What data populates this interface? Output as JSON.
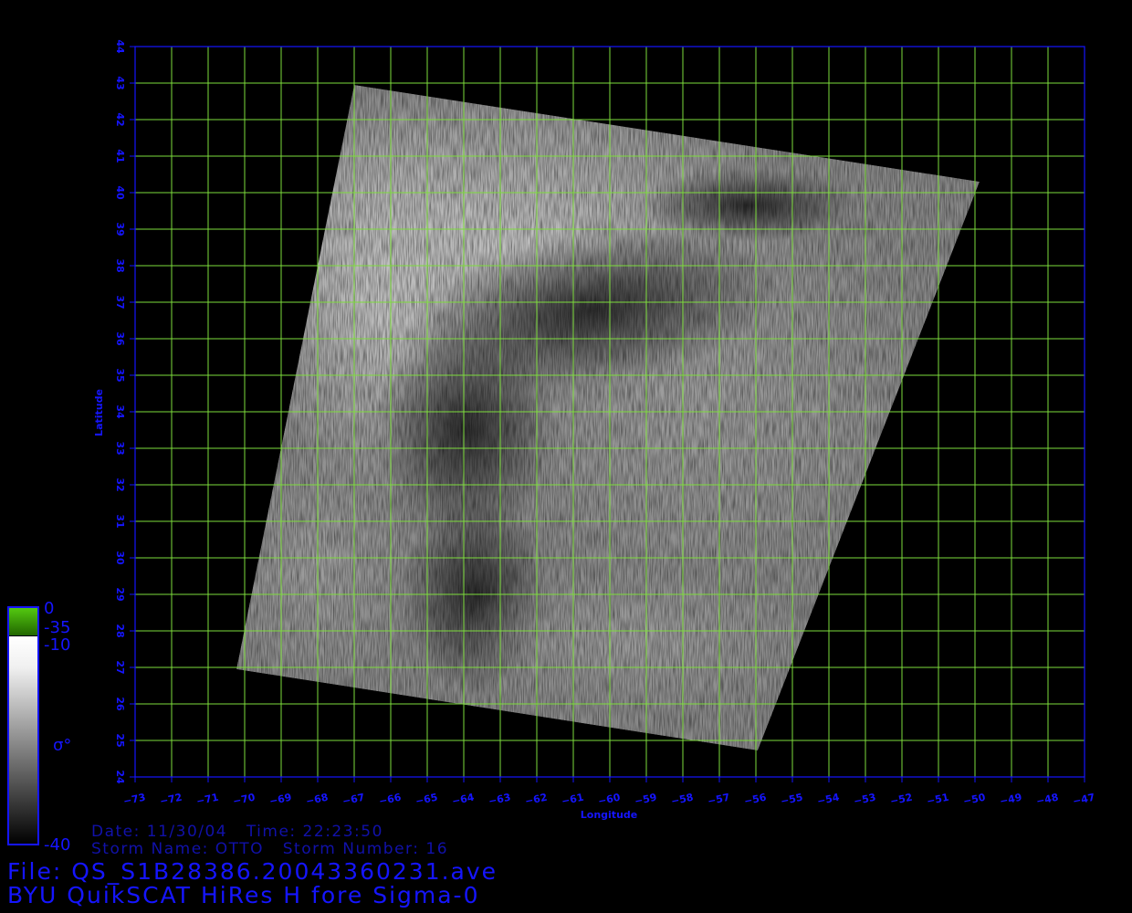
{
  "map": {
    "x_axis_label": "Longitude",
    "y_axis_label": "Latitude",
    "lon_range": [
      -73,
      -47
    ],
    "lat_range": [
      24,
      44
    ],
    "lon_ticks": [
      -73,
      -72,
      -71,
      -70,
      -69,
      -68,
      -67,
      -66,
      -65,
      -64,
      -63,
      -62,
      -61,
      -60,
      -59,
      -58,
      -57,
      -56,
      -55,
      -54,
      -53,
      -52,
      -51,
      -50,
      -49,
      -48,
      -47
    ],
    "lat_ticks": [
      24,
      25,
      26,
      27,
      28,
      29,
      30,
      31,
      32,
      33,
      34,
      35,
      36,
      37,
      38,
      39,
      40,
      41,
      42,
      43,
      44
    ],
    "colors": {
      "axis": "#1515ff",
      "grid": "#7ddc3c",
      "background": "#000000"
    }
  },
  "colorbar": {
    "top_label": "0",
    "label_2": "-35",
    "label_3": "-10",
    "bottom_label": "-40",
    "title": "σ°",
    "colors": {
      "green_top": "#44bb00",
      "white": "#ffffff",
      "black": "#000000"
    }
  },
  "info": {
    "date_line": "Date: 11/30/04   Time: 22:23:50",
    "storm_line": "Storm Name: OTTO   Storm Number: 16",
    "file_line": "File: QS_S1B28386.20043360231.ave",
    "product_line": "BYU QuikSCAT HiRes H fore Sigma-0"
  }
}
